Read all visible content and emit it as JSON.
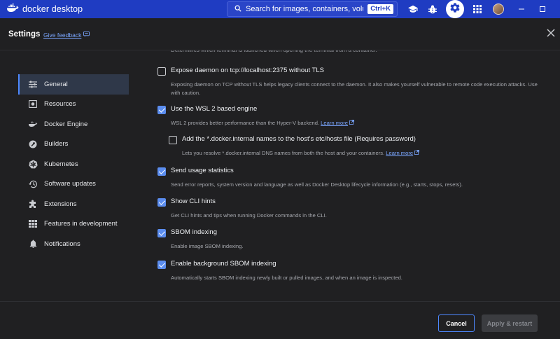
{
  "app": {
    "name": "docker desktop",
    "search_placeholder": "Search for images, containers, volume...",
    "search_shortcut": "Ctrl+K"
  },
  "header": {
    "title": "Settings",
    "feedback_link": "Give feedback"
  },
  "sidebar": {
    "items": [
      {
        "label": "General",
        "icon": "sliders-icon",
        "active": true
      },
      {
        "label": "Resources",
        "icon": "resources-icon"
      },
      {
        "label": "Docker Engine",
        "icon": "whale-icon"
      },
      {
        "label": "Builders",
        "icon": "wrench-icon"
      },
      {
        "label": "Kubernetes",
        "icon": "helm-icon"
      },
      {
        "label": "Software updates",
        "icon": "history-icon"
      },
      {
        "label": "Extensions",
        "icon": "puzzle-icon"
      },
      {
        "label": "Features in development",
        "icon": "grid-icon"
      },
      {
        "label": "Notifications",
        "icon": "bell-icon"
      }
    ]
  },
  "content": {
    "cut_text": "Determines which terminal is launched when opening the terminal from a container.",
    "options": [
      {
        "label": "Expose daemon on tcp://localhost:2375 without TLS",
        "desc": "Exposing daemon on TCP without TLS helps legacy clients connect to the daemon. It also makes yourself vulnerable to remote code execution attacks. Use with caution.",
        "checked": false
      },
      {
        "label": "Use the WSL 2 based engine",
        "desc": "WSL 2 provides better performance than the Hyper-V backend.",
        "learn_more": "Learn more",
        "checked": true
      },
      {
        "label": "Add the *.docker.internal names to the host's etc/hosts file (Requires password)",
        "desc": "Lets you resolve *.docker.internal DNS names from both the host and your containers.",
        "learn_more": "Learn more",
        "checked": false
      },
      {
        "label": "Send usage statistics",
        "desc": "Send error reports, system version and language as well as Docker Desktop lifecycle information (e.g., starts, stops, resets).",
        "checked": true
      },
      {
        "label": "Show CLI hints",
        "desc": "Get CLI hints and tips when running Docker commands in the CLI.",
        "checked": true
      },
      {
        "label": "SBOM indexing",
        "desc": "Enable image SBOM indexing.",
        "checked": true
      },
      {
        "label": "Enable background SBOM indexing",
        "desc": "Automatically starts SBOM indexing newly built or pulled images, and when an image is inspected.",
        "checked": true
      }
    ]
  },
  "footer": {
    "cancel_label": "Cancel",
    "apply_label": "Apply & restart"
  },
  "colors": {
    "titlebar": "#1f3cc2",
    "accent": "#4d88ff",
    "background": "#202022"
  }
}
